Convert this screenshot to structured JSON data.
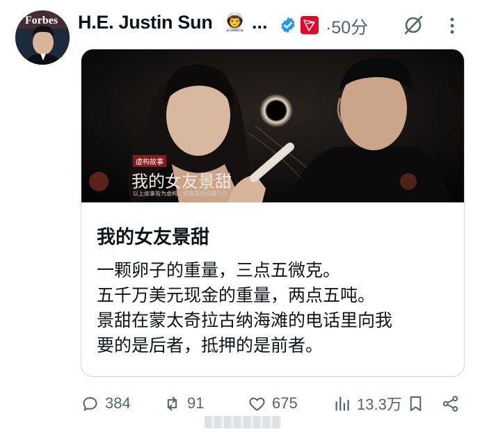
{
  "author": {
    "name": "H.E. Justin Sun",
    "emoji": "👨‍🚀",
    "ellipsis": "...",
    "timestamp": "·50分",
    "avatar_text": "Forbes"
  },
  "card": {
    "image_badge": "虚构故事",
    "image_title": "我的女友景甜",
    "image_caption": "以上故事皆为虚构，如有雷同纯属巧合",
    "title": "我的女友景甜",
    "lines": [
      "一颗卵子的重量，三点五微克。",
      "五千万美元现金的重量，两点五吨。",
      "景甜在蒙太奇拉古纳海滩的电话里向我",
      "要的是后者，抵押的是前者。"
    ]
  },
  "actions": {
    "reply_count": "384",
    "retweet_count": "91",
    "like_count": "675",
    "views_count": "13.3万"
  },
  "colors": {
    "text": "#0f1419",
    "muted": "#536471",
    "verified": "#1d9bf0",
    "tron": "#eb0029",
    "border": "#cfd9de"
  },
  "icons": [
    "verified-badge-icon",
    "tron-logo-icon",
    "grok-icon",
    "more-icon",
    "reply-icon",
    "retweet-icon",
    "like-icon",
    "views-icon",
    "bookmark-icon",
    "share-icon"
  ]
}
